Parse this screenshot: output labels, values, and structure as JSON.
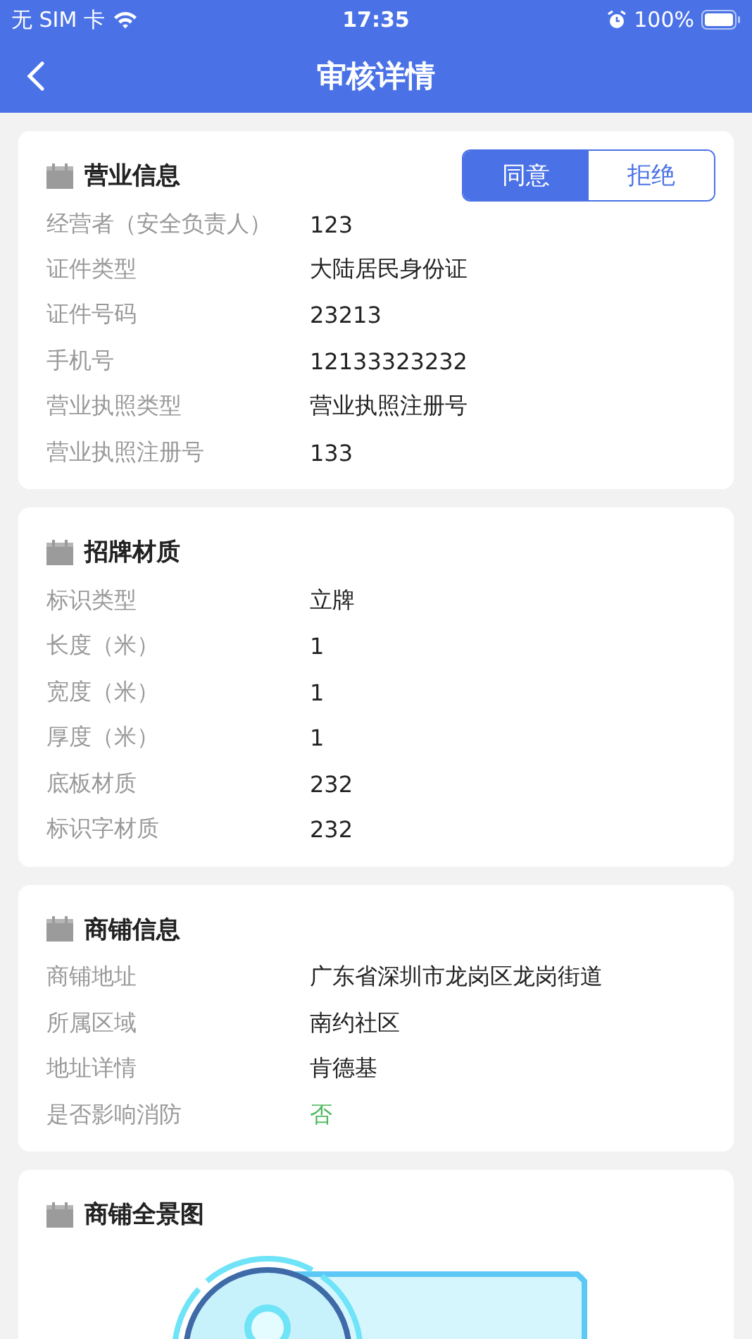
{
  "status_bar": {
    "carrier": "无 SIM 卡",
    "time": "17:35",
    "battery": "100%"
  },
  "nav": {
    "title": "审核详情"
  },
  "sections": [
    {
      "title": "营业信息",
      "actions": [
        {
          "label": "同意",
          "selected": true
        },
        {
          "label": "拒绝",
          "selected": false
        }
      ],
      "rows": [
        {
          "label": "经营者（安全负责人）",
          "value": "123"
        },
        {
          "label": "证件类型",
          "value": "大陆居民身份证"
        },
        {
          "label": "证件号码",
          "value": "23213"
        },
        {
          "label": "手机号",
          "value": "12133323232"
        },
        {
          "label": "营业执照类型",
          "value": "营业执照注册号"
        },
        {
          "label": "营业执照注册号",
          "value": "133"
        }
      ]
    },
    {
      "title": "招牌材质",
      "rows": [
        {
          "label": "标识类型",
          "value": "立牌"
        },
        {
          "label": "长度（米）",
          "value": "1"
        },
        {
          "label": "宽度（米）",
          "value": "1"
        },
        {
          "label": "厚度（米）",
          "value": "1"
        },
        {
          "label": "底板材质",
          "value": "232"
        },
        {
          "label": "标识字材质",
          "value": "232"
        }
      ]
    },
    {
      "title": "商铺信息",
      "rows": [
        {
          "label": "商铺地址",
          "value": "广东省深圳市龙岗区龙岗街道"
        },
        {
          "label": "所属区域",
          "value": "南约社区"
        },
        {
          "label": "地址详情",
          "value": "肯德基"
        },
        {
          "label": "是否影响消防",
          "value": "否",
          "color": "#4cb85c"
        }
      ]
    },
    {
      "title": "商铺全景图"
    }
  ]
}
